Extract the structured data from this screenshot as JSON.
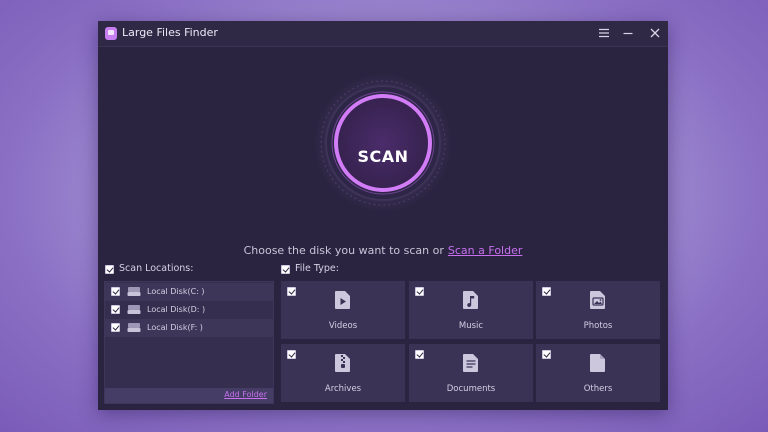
{
  "window": {
    "title": "Large Files Finder"
  },
  "scan": {
    "button_label": "SCAN",
    "prompt_text": "Choose the disk you want to scan or",
    "scan_folder_link": "Scan a Folder"
  },
  "scan_locations": {
    "label": "Scan Locations:",
    "checked": true,
    "items": [
      {
        "label": "Local Disk(C: )",
        "checked": true
      },
      {
        "label": "Local Disk(D: )",
        "checked": true
      },
      {
        "label": "Local Disk(F: )",
        "checked": true
      }
    ],
    "add_folder_label": "Add Folder"
  },
  "file_types": {
    "label": "File Type:",
    "checked": true,
    "items": [
      {
        "label": "Videos",
        "icon": "video-file-icon",
        "checked": true
      },
      {
        "label": "Music",
        "icon": "music-file-icon",
        "checked": true
      },
      {
        "label": "Photos",
        "icon": "photo-file-icon",
        "checked": true
      },
      {
        "label": "Archives",
        "icon": "archive-file-icon",
        "checked": true
      },
      {
        "label": "Documents",
        "icon": "document-file-icon",
        "checked": true
      },
      {
        "label": "Others",
        "icon": "other-file-icon",
        "checked": true
      }
    ]
  },
  "colors": {
    "accent": "#c870f0",
    "window_bg": "#2a2440",
    "panel_bg": "#3a3356"
  }
}
